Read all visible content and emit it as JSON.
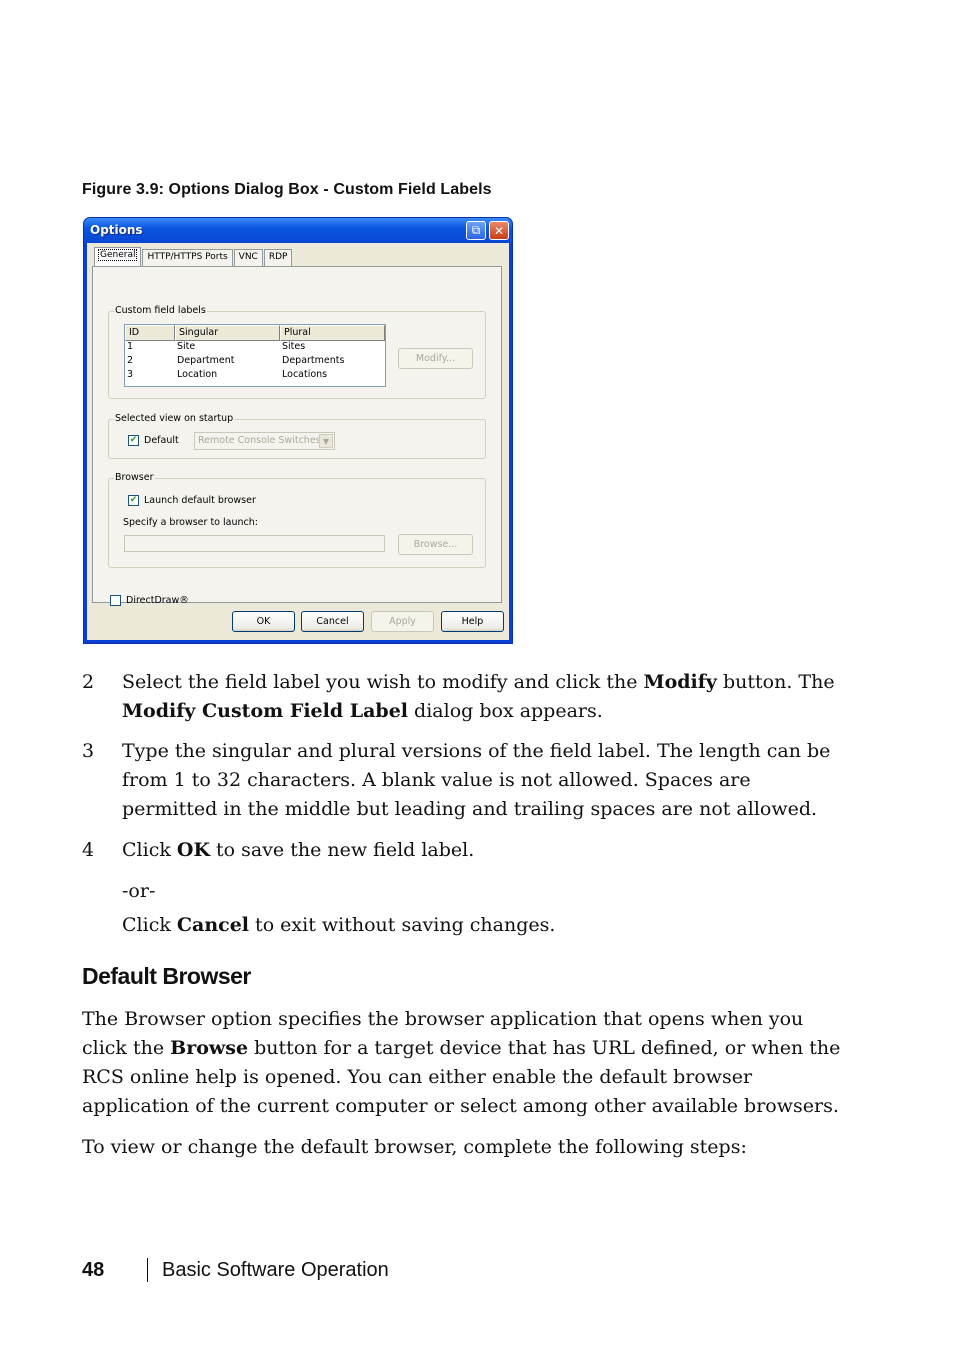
{
  "figure": {
    "caption": "Figure 3.9: Options Dialog Box - Custom Field Labels"
  },
  "dialog": {
    "title": "Options",
    "title_buttons": {
      "restore_icon": "restore-icon",
      "close_icon": "close-icon",
      "close_glyph": "✕",
      "restore_glyph": "⧉"
    },
    "tabs": [
      {
        "label": "General",
        "active": true
      },
      {
        "label": "HTTP/HTTPS Ports",
        "active": false
      },
      {
        "label": "VNC",
        "active": false
      },
      {
        "label": "RDP",
        "active": false
      }
    ],
    "custom_field_labels": {
      "group_label": "Custom field labels",
      "columns": [
        "ID",
        "Singular",
        "Plural"
      ],
      "rows": [
        {
          "id": "1",
          "singular": "Site",
          "plural": "Sites"
        },
        {
          "id": "2",
          "singular": "Department",
          "plural": "Departments"
        },
        {
          "id": "3",
          "singular": "Location",
          "plural": "Locations"
        }
      ],
      "modify_button": "Modify..."
    },
    "startup_view": {
      "group_label": "Selected view on startup",
      "default_checkbox": "Default",
      "default_checked": true,
      "view_select_value": "Remote Console Switches"
    },
    "browser": {
      "group_label": "Browser",
      "launch_default_checkbox": "Launch default browser",
      "launch_default_checked": true,
      "specify_label": "Specify a browser to launch:",
      "browser_path_value": "",
      "browse_button": "Browse..."
    },
    "directdraw_checkbox": "DirectDraw®",
    "directdraw_checked": false,
    "buttons": {
      "ok": "OK",
      "cancel": "Cancel",
      "apply": "Apply",
      "help": "Help"
    }
  },
  "steps": [
    {
      "number": "2",
      "parts": [
        {
          "t": "Select the field label you wish to modify and click the "
        },
        {
          "b": "Modify"
        },
        {
          "t": " button. The "
        },
        {
          "b": "Modify Custom Field Label"
        },
        {
          "t": " dialog box appears."
        }
      ]
    },
    {
      "number": "3",
      "parts": [
        {
          "t": "Type the singular and plural versions of the field label. The length can be from 1 to 32 characters. A blank value is not allowed. Spaces are permitted in the middle but leading and trailing spaces are not allowed."
        }
      ]
    },
    {
      "number": "4",
      "parts": [
        {
          "t": "Click "
        },
        {
          "b": "OK"
        },
        {
          "t": " to save the new field label."
        }
      ]
    }
  ],
  "step4_or": "-or-",
  "step4_alt": [
    {
      "t": "Click "
    },
    {
      "b": "Cancel"
    },
    {
      "t": " to exit without saving changes."
    }
  ],
  "section": {
    "heading": "Default Browser",
    "paragraph1": [
      {
        "t": "The Browser option specifies the browser application that opens when you click the "
      },
      {
        "b": "Browse"
      },
      {
        "t": " button for a target device that has URL defined, or when the RCS online help is opened. You can either enable the default browser application of the current computer or select among other available browsers."
      }
    ],
    "paragraph2": "To view or change the default browser, complete the following steps:"
  },
  "footer": {
    "page_number": "48",
    "chapter_title": "Basic Software Operation"
  }
}
